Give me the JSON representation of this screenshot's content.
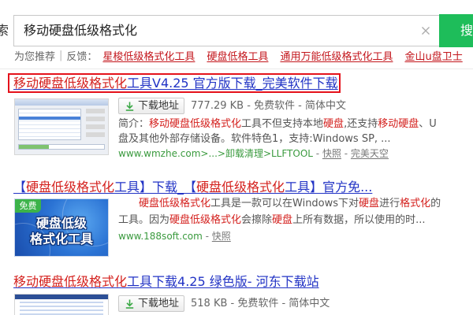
{
  "colors": {
    "link": "#2233c5",
    "highlight": "#d4201d",
    "url": "#3a9a3e",
    "text": "#555555",
    "muted": "#777777",
    "accent": "#1ebd5a",
    "box": "#e5121b",
    "recommend": "#c3161c",
    "download_icon": "#3aa845",
    "badge": "#3cb34a"
  },
  "icons": {
    "clear": "close-icon",
    "download": "download-icon"
  },
  "ui": {
    "separator": " - "
  },
  "search": {
    "label_fragment": "索",
    "query": "移动硬盘低级格式化",
    "button_label": "搜"
  },
  "recommend": {
    "label": "为您推荐",
    "divider": "|",
    "feedback": "反馈：",
    "links": [
      "星梭低级格式化工具",
      "硬盘低格工具",
      "通用万能低级格式化工具",
      "金山u盘卫士"
    ]
  },
  "results": [
    {
      "title": [
        {
          "text": "移动硬盘低级格式化",
          "hl": true
        },
        {
          "text": "工具V4.25 官方版下载_完美软件下载",
          "hl": false
        }
      ],
      "download_label": "下载地址",
      "meta": "777.29 KB - 免费软件 - 简体中文",
      "desc_lines": [
        [
          {
            "text": "简介：",
            "hl": false
          },
          {
            "text": "移动硬盘低级格式化",
            "hl": true
          },
          {
            "text": "工具不但支持本地",
            "hl": false
          },
          {
            "text": "硬盘",
            "hl": true
          },
          {
            "text": ",还支持",
            "hl": false
          },
          {
            "text": "移动硬盘",
            "hl": true
          },
          {
            "text": "、U",
            "hl": false
          }
        ],
        [
          {
            "text": "盘及其他外部存储设备。软件特色1，支持:Windows SP, ...",
            "hl": false
          }
        ]
      ],
      "url": "www.wmzhe.com>...>卸载清理>LLFTOOL",
      "links": [
        "快照",
        "完美天空"
      ]
    },
    {
      "title": [
        {
          "text": "【",
          "hl": false
        },
        {
          "text": "硬盘低级格式化",
          "hl": true
        },
        {
          "text": "工具】下载_【",
          "hl": false
        },
        {
          "text": "硬盘低级格式化",
          "hl": true
        },
        {
          "text": "工具】官方免...",
          "hl": false
        }
      ],
      "thumbnail": {
        "badge": "免费",
        "lines": [
          "硬盘低级",
          "格式化工具"
        ]
      },
      "desc_lines": [
        [
          {
            "text": "硬盘低级格式化",
            "hl": true
          },
          {
            "text": "工具是一款可以在Windows下对",
            "hl": false
          },
          {
            "text": "硬盘",
            "hl": true
          },
          {
            "text": "进行",
            "hl": false
          },
          {
            "text": "格式化",
            "hl": true
          },
          {
            "text": "的",
            "hl": false
          }
        ],
        [
          {
            "text": "工具。因为",
            "hl": false
          },
          {
            "text": "硬盘低级格式化",
            "hl": true
          },
          {
            "text": "会擦除",
            "hl": false
          },
          {
            "text": "硬盘",
            "hl": true
          },
          {
            "text": "上所有数据，所以使用的时...",
            "hl": false
          }
        ]
      ],
      "url": "www.188soft.com",
      "links": [
        "快照"
      ]
    },
    {
      "title": [
        {
          "text": "移动硬盘低级格式化",
          "hl": true
        },
        {
          "text": "工具下载4.25 绿色版- 河东下载站",
          "hl": false
        }
      ],
      "download_label": "下载地址",
      "meta": "518 KB - 免费软件 - 简体中文"
    }
  ]
}
